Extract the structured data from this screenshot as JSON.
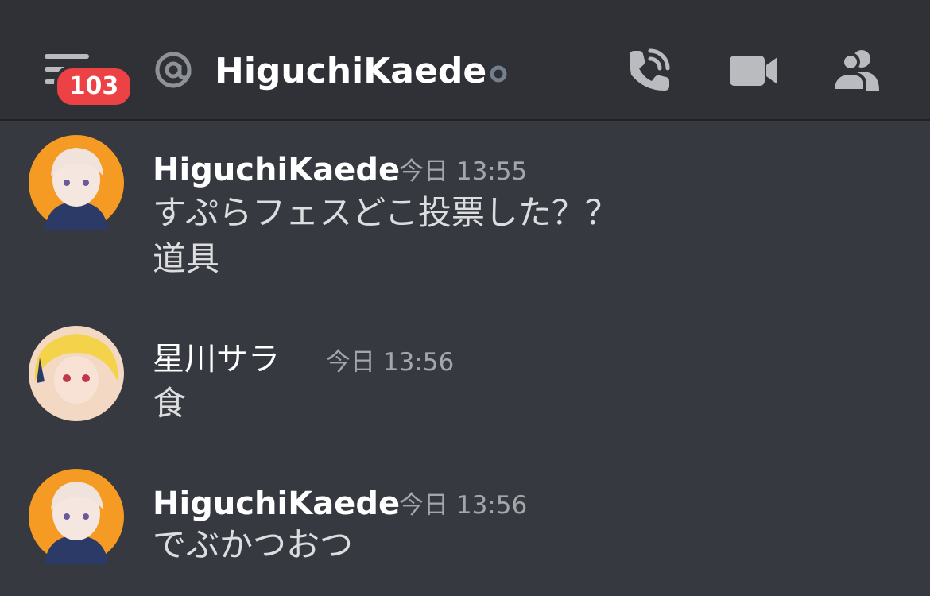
{
  "header": {
    "unread_badge": "103",
    "channel_name": "HiguchiKaede",
    "icons": {
      "menu": "hamburger-menu-icon",
      "at": "at-sign-icon",
      "status": "offline-status-icon",
      "call": "phone-call-icon",
      "video": "video-camera-icon",
      "members": "members-icon"
    }
  },
  "colors": {
    "background": "#36393f",
    "header_background": "#2f3136",
    "badge": "#ed4245",
    "avatar_orange": "#f59a23"
  },
  "messages": [
    {
      "author": "HiguchiKaede",
      "timestamp": "今日 13:55",
      "lines": [
        "すぷらフェスどこ投票した？？",
        "道具"
      ]
    },
    {
      "author": "星川サラ",
      "timestamp": "今日 13:56",
      "lines": [
        "食"
      ]
    },
    {
      "author": "HiguchiKaede",
      "timestamp": "今日 13:56",
      "lines": [
        "でぶかつおつ"
      ]
    }
  ]
}
